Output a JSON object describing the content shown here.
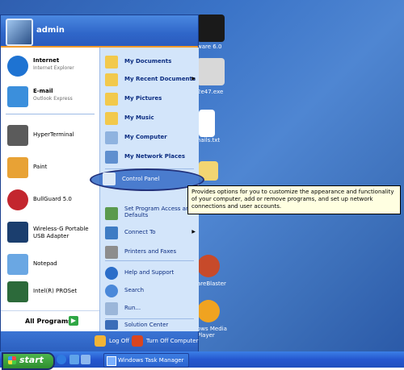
{
  "user": {
    "name": "admin"
  },
  "desktop_icons": [
    {
      "label": "ware 6.0",
      "icon": "vmware-icon"
    },
    {
      "label": "2e47.exe",
      "icon": "exe-icon"
    },
    {
      "label": "nails.txt",
      "icon": "text-file-icon"
    },
    {
      "label": "",
      "icon": "network-folder-icon"
    },
    {
      "label": "areBlaster",
      "icon": "malwareblaster-icon"
    },
    {
      "label": "ows Media Player",
      "icon": "media-player-icon"
    }
  ],
  "pinned": [
    {
      "title": "Internet",
      "subtitle": "Internet Explorer",
      "icon": "internet-explorer-icon",
      "color": "#1e73d2"
    },
    {
      "title": "E-mail",
      "subtitle": "Outlook Express",
      "icon": "email-icon",
      "color": "#3b8fdc"
    }
  ],
  "recent": [
    {
      "label": "HyperTerminal",
      "icon": "hyperterminal-icon",
      "color": "#5b5b5b"
    },
    {
      "label": "Paint",
      "icon": "paint-icon",
      "color": "#e8a235"
    },
    {
      "label": "BullGuard 5.0",
      "icon": "bullguard-icon",
      "color": "#c3262e"
    },
    {
      "label": "Wireless-G Portable USB Adapter",
      "icon": "linksys-icon",
      "color": "#1b3e6e"
    },
    {
      "label": "Notepad",
      "icon": "notepad-icon",
      "color": "#6aa7e3"
    },
    {
      "label": "Intel(R) PROSet",
      "icon": "intel-proset-icon",
      "color": "#2c6a3a"
    }
  ],
  "all_programs_label": "All Programs",
  "right_items": [
    {
      "label": "My Documents",
      "icon": "folder-icon",
      "bold": true
    },
    {
      "label": "My Recent Documents",
      "icon": "folder-icon",
      "bold": true,
      "arrow": "▶"
    },
    {
      "label": "My Pictures",
      "icon": "folder-icon",
      "bold": true
    },
    {
      "label": "My Music",
      "icon": "folder-icon",
      "bold": true
    },
    {
      "label": "My Computer",
      "icon": "computer-icon",
      "bold": true
    },
    {
      "label": "My Network Places",
      "icon": "network-icon",
      "bold": true
    },
    {
      "label": "Control Panel",
      "icon": "control-panel-icon",
      "bold": false
    },
    {
      "label": "Set Program Access and Defaults",
      "icon": "program-access-icon",
      "bold": false
    },
    {
      "label": "Connect To",
      "icon": "connect-icon",
      "bold": false,
      "arrow": "▶"
    },
    {
      "label": "Printers and Faxes",
      "icon": "printer-icon",
      "bold": false
    },
    {
      "label": "Help and Support",
      "icon": "help-icon",
      "bold": false
    },
    {
      "label": "Search",
      "icon": "search-icon",
      "bold": false
    },
    {
      "label": "Run...",
      "icon": "run-icon",
      "bold": false
    },
    {
      "label": "Solution Center",
      "icon": "dell-icon",
      "bold": false
    }
  ],
  "tooltip": "Provides options for you to customize the appearance and functionality of your computer, add or remove programs, and set up network connections and user accounts.",
  "footer": {
    "log_off": "Log Off",
    "turn_off": "Turn Off Computer"
  },
  "taskbar": {
    "start": "start",
    "task": "Windows Task Manager"
  },
  "colors": {
    "highlight": "#316ac5",
    "accent": "#f49c2b"
  }
}
